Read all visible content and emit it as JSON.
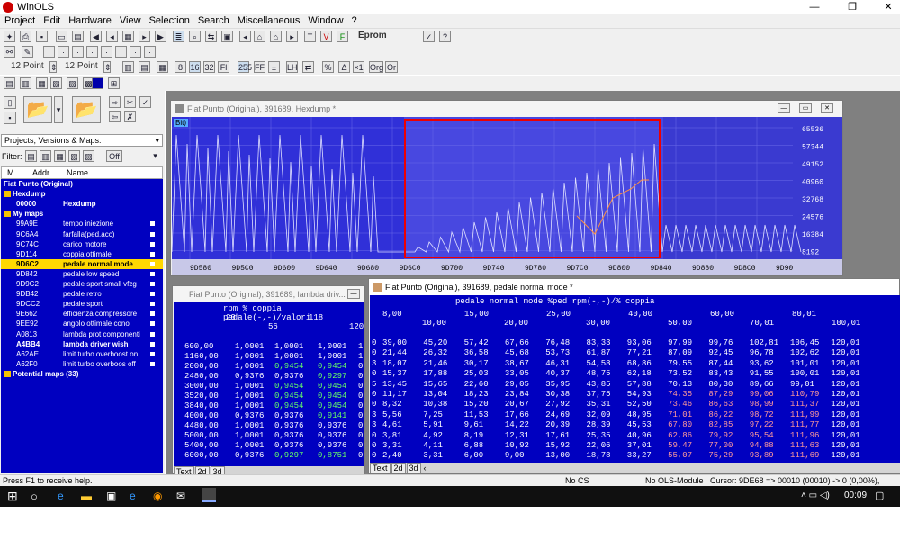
{
  "app": {
    "title": "WinOLS"
  },
  "menu": [
    "Project",
    "Edit",
    "Hardware",
    "View",
    "Selection",
    "Search",
    "Miscellaneous",
    "Window",
    "?"
  ],
  "toolbar": {
    "eprom": "Eprom",
    "point1": "12 Point",
    "point2": "12 Point"
  },
  "left": {
    "dropdown": "Projects, Versions & Maps:",
    "filter_label": "Filter:",
    "filter_off": "Off",
    "col_m": "M",
    "col_addr": "Addr...",
    "col_name": "Name"
  },
  "tree": [
    {
      "code": "Fiat Punto (Original)",
      "name": "",
      "bold": true,
      "folder": false,
      "ind": 0,
      "ico": false
    },
    {
      "code": "Hexdump",
      "name": "",
      "bold": true,
      "folder": true,
      "ind": 1,
      "ico": false
    },
    {
      "code": "00000",
      "name": "Hexdump",
      "bold": true,
      "folder": false,
      "ind": 2,
      "ico": false
    },
    {
      "code": "My maps",
      "name": "",
      "bold": true,
      "folder": true,
      "ind": 1,
      "ico": false
    },
    {
      "code": "99A9E",
      "name": "tempo iniezione",
      "bold": false,
      "folder": false,
      "ind": 2,
      "ico": true
    },
    {
      "code": "9C6A4",
      "name": "farfalla(ped.acc)",
      "bold": false,
      "folder": false,
      "ind": 2,
      "ico": true
    },
    {
      "code": "9C74C",
      "name": "carico motore",
      "bold": false,
      "folder": false,
      "ind": 2,
      "ico": true
    },
    {
      "code": "9D114",
      "name": "coppia ottimale",
      "bold": false,
      "folder": false,
      "ind": 2,
      "ico": true
    },
    {
      "code": "9D6C2",
      "name": "pedale normal mode",
      "bold": true,
      "folder": false,
      "ind": 2,
      "ico": true,
      "sel": true
    },
    {
      "code": "9D842",
      "name": "pedale low speed",
      "bold": false,
      "folder": false,
      "ind": 2,
      "ico": true
    },
    {
      "code": "9D9C2",
      "name": "pedale sport small vfzg",
      "bold": false,
      "folder": false,
      "ind": 2,
      "ico": true
    },
    {
      "code": "9DB42",
      "name": "pedale retro",
      "bold": false,
      "folder": false,
      "ind": 2,
      "ico": true
    },
    {
      "code": "9DCC2",
      "name": "pedale sport",
      "bold": false,
      "folder": false,
      "ind": 2,
      "ico": true
    },
    {
      "code": "9E662",
      "name": "efficienza compressore",
      "bold": false,
      "folder": false,
      "ind": 2,
      "ico": true
    },
    {
      "code": "9EE92",
      "name": "angolo ottimale cono",
      "bold": false,
      "folder": false,
      "ind": 2,
      "ico": true
    },
    {
      "code": "A0813",
      "name": "lambda prot componenti",
      "bold": false,
      "folder": false,
      "ind": 2,
      "ico": true
    },
    {
      "code": "A4BB4",
      "name": "lambda driver wish",
      "bold": true,
      "folder": false,
      "ind": 2,
      "ico": true
    },
    {
      "code": "A62AE",
      "name": "limit turbo overboost on",
      "bold": false,
      "folder": false,
      "ind": 2,
      "ico": true
    },
    {
      "code": "A62F0",
      "name": "limit turbo overboos off",
      "bold": false,
      "folder": false,
      "ind": 2,
      "ico": true
    },
    {
      "code": "Potential maps (33)",
      "name": "",
      "bold": true,
      "folder": true,
      "ind": 1,
      "ico": false
    }
  ],
  "hexwin": {
    "title": "Fiat Punto (Original), 391689, Hexdump *",
    "bit": "Bit)",
    "yticks": [
      "65536",
      "57344",
      "49152",
      "40960",
      "32768",
      "24576",
      "16384",
      "8192"
    ],
    "xticks": [
      "9D580",
      "9D5C0",
      "9D600",
      "9D640",
      "9D680",
      "9D6C0",
      "9D700",
      "9D740",
      "9D780",
      "9D7C0",
      "9D800",
      "9D840",
      "9D880",
      "9D8C0",
      "9D90"
    ]
  },
  "lambdawin": {
    "title": "Fiat Punto (Original), 391689, lambda driv...",
    "header": "rpm % coppia pedale(-,-)/valori",
    "h1": [
      "20",
      "118"
    ],
    "h2": [
      "56",
      "120"
    ],
    "rows": [
      [
        "600,00",
        "1,0001",
        "1,0001",
        "1,0001",
        "1,"
      ],
      [
        "1160,00",
        "1,0001",
        "1,0001",
        "1,0001",
        "1,"
      ],
      [
        "2000,00",
        "1,0001",
        "0,9454",
        "0,9454",
        "0,"
      ],
      [
        "2480,00",
        "0,9376",
        "0,9376",
        "0,9297",
        "0,"
      ],
      [
        "3000,00",
        "1,0001",
        "0,9454",
        "0,9454",
        "0,"
      ],
      [
        "3520,00",
        "1,0001",
        "0,9454",
        "0,9454",
        "0,"
      ],
      [
        "3840,00",
        "1,0001",
        "0,9454",
        "0,9454",
        "0,"
      ],
      [
        "4000,00",
        "0,9376",
        "0,9376",
        "0,9141",
        "0,"
      ],
      [
        "4480,00",
        "1,0001",
        "0,9376",
        "0,9376",
        "0,"
      ],
      [
        "5000,00",
        "1,0001",
        "0,9376",
        "0,9376",
        "0,"
      ],
      [
        "5400,00",
        "1,0001",
        "0,9376",
        "0,9376",
        "0,"
      ],
      [
        "6000,00",
        "0,9376",
        "0,9297",
        "0,8751",
        "0,"
      ]
    ]
  },
  "pedalwin": {
    "title": "Fiat Punto (Original), 391689, pedale normal mode *",
    "header": "pedale normal mode %ped rpm(-,-)/% coppia",
    "h1": [
      "8,00",
      "15,00",
      "25,00",
      "40,00",
      "60,00",
      "80,01"
    ],
    "h2": [
      "10,00",
      "20,00",
      "30,00",
      "50,00",
      "70,01",
      "100,01"
    ],
    "rows": [
      [
        "0",
        "39,00",
        "45,20",
        "57,42",
        "67,66",
        "76,48",
        "83,33",
        "93,06",
        "97,99",
        "99,76",
        "102,81",
        "106,45",
        "120,01"
      ],
      [
        "0",
        "21,44",
        "26,32",
        "36,58",
        "45,68",
        "53,73",
        "61,87",
        "77,21",
        "87,09",
        "92,45",
        "96,78",
        "102,62",
        "120,01"
      ],
      [
        "3",
        "18,07",
        "21,46",
        "30,17",
        "38,67",
        "46,31",
        "54,58",
        "68,86",
        "79,55",
        "87,44",
        "93,62",
        "101,01",
        "120,01"
      ],
      [
        "0",
        "15,37",
        "17,88",
        "25,03",
        "33,05",
        "40,37",
        "48,75",
        "62,18",
        "73,52",
        "83,43",
        "91,55",
        "100,01",
        "120,01"
      ],
      [
        "5",
        "13,45",
        "15,65",
        "22,60",
        "29,05",
        "35,95",
        "43,85",
        "57,88",
        "70,13",
        "80,30",
        "89,66",
        "99,01",
        "120,01"
      ],
      [
        "0",
        "11,17",
        "13,04",
        "18,23",
        "23,84",
        "30,38",
        "37,75",
        "54,93",
        "74,35",
        "87,29",
        "99,06",
        "110,79",
        "120,01"
      ],
      [
        "0",
        "8,32",
        "10,38",
        "15,20",
        "20,67",
        "27,92",
        "35,31",
        "52,50",
        "73,46",
        "86,63",
        "98,99",
        "111,37",
        "120,01"
      ],
      [
        "3",
        "5,56",
        "7,25",
        "11,53",
        "17,66",
        "24,69",
        "32,09",
        "48,95",
        "71,01",
        "86,22",
        "98,72",
        "111,99",
        "120,01"
      ],
      [
        "3",
        "4,61",
        "5,91",
        "9,61",
        "14,22",
        "20,39",
        "28,39",
        "45,53",
        "67,80",
        "82,85",
        "97,22",
        "111,77",
        "120,01"
      ],
      [
        "0",
        "3,81",
        "4,92",
        "8,19",
        "12,31",
        "17,61",
        "25,35",
        "40,96",
        "62,86",
        "79,92",
        "95,54",
        "111,96",
        "120,01"
      ],
      [
        "0",
        "3,31",
        "4,11",
        "6,88",
        "10,92",
        "15,92",
        "22,06",
        "37,01",
        "59,47",
        "77,00",
        "94,88",
        "111,63",
        "120,01"
      ],
      [
        "0",
        "2,40",
        "3,31",
        "6,00",
        "9,00",
        "13,00",
        "18,78",
        "33,27",
        "55,07",
        "75,29",
        "93,89",
        "111,69",
        "120,01"
      ]
    ]
  },
  "tabs": [
    "Text",
    "2d",
    "3d"
  ],
  "status": {
    "help": "Press F1 to receive help.",
    "cs": "No CS",
    "ols": "No OLS-Module",
    "cursor": "Cursor: 9DE68 => 00010 (00010) -> 0 (0,00%), Width: 12"
  },
  "taskbar": {
    "time": "00:09"
  }
}
